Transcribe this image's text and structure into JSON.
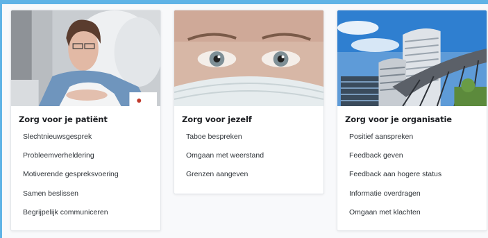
{
  "cards": [
    {
      "image": "patient-in-hospital-bed-photo",
      "title": "Zorg voor je patiënt",
      "links": [
        "Slechtnieuwsgesprek",
        "Probleemverheldering",
        "Motiverende gespreksvoering",
        "Samen beslissen",
        "Begrijpelijk communiceren"
      ]
    },
    {
      "image": "face-with-surgical-mask-photo",
      "title": "Zorg voor jezelf",
      "links": [
        "Taboe bespreken",
        "Omgaan met weerstand",
        "Grenzen aangeven"
      ]
    },
    {
      "image": "hospital-building-exterior-photo",
      "title": "Zorg voor je organisatie",
      "links": [
        "Positief aanspreken",
        "Feedback geven",
        "Feedback aan hogere status",
        "Informatie overdragen",
        "Omgaan met klachten"
      ]
    }
  ],
  "colors": {
    "accent_strip": "#5fb3e6",
    "title_text": "#1d1f23",
    "link_text": "#2e3338",
    "page_background": "#f8f9fb"
  }
}
